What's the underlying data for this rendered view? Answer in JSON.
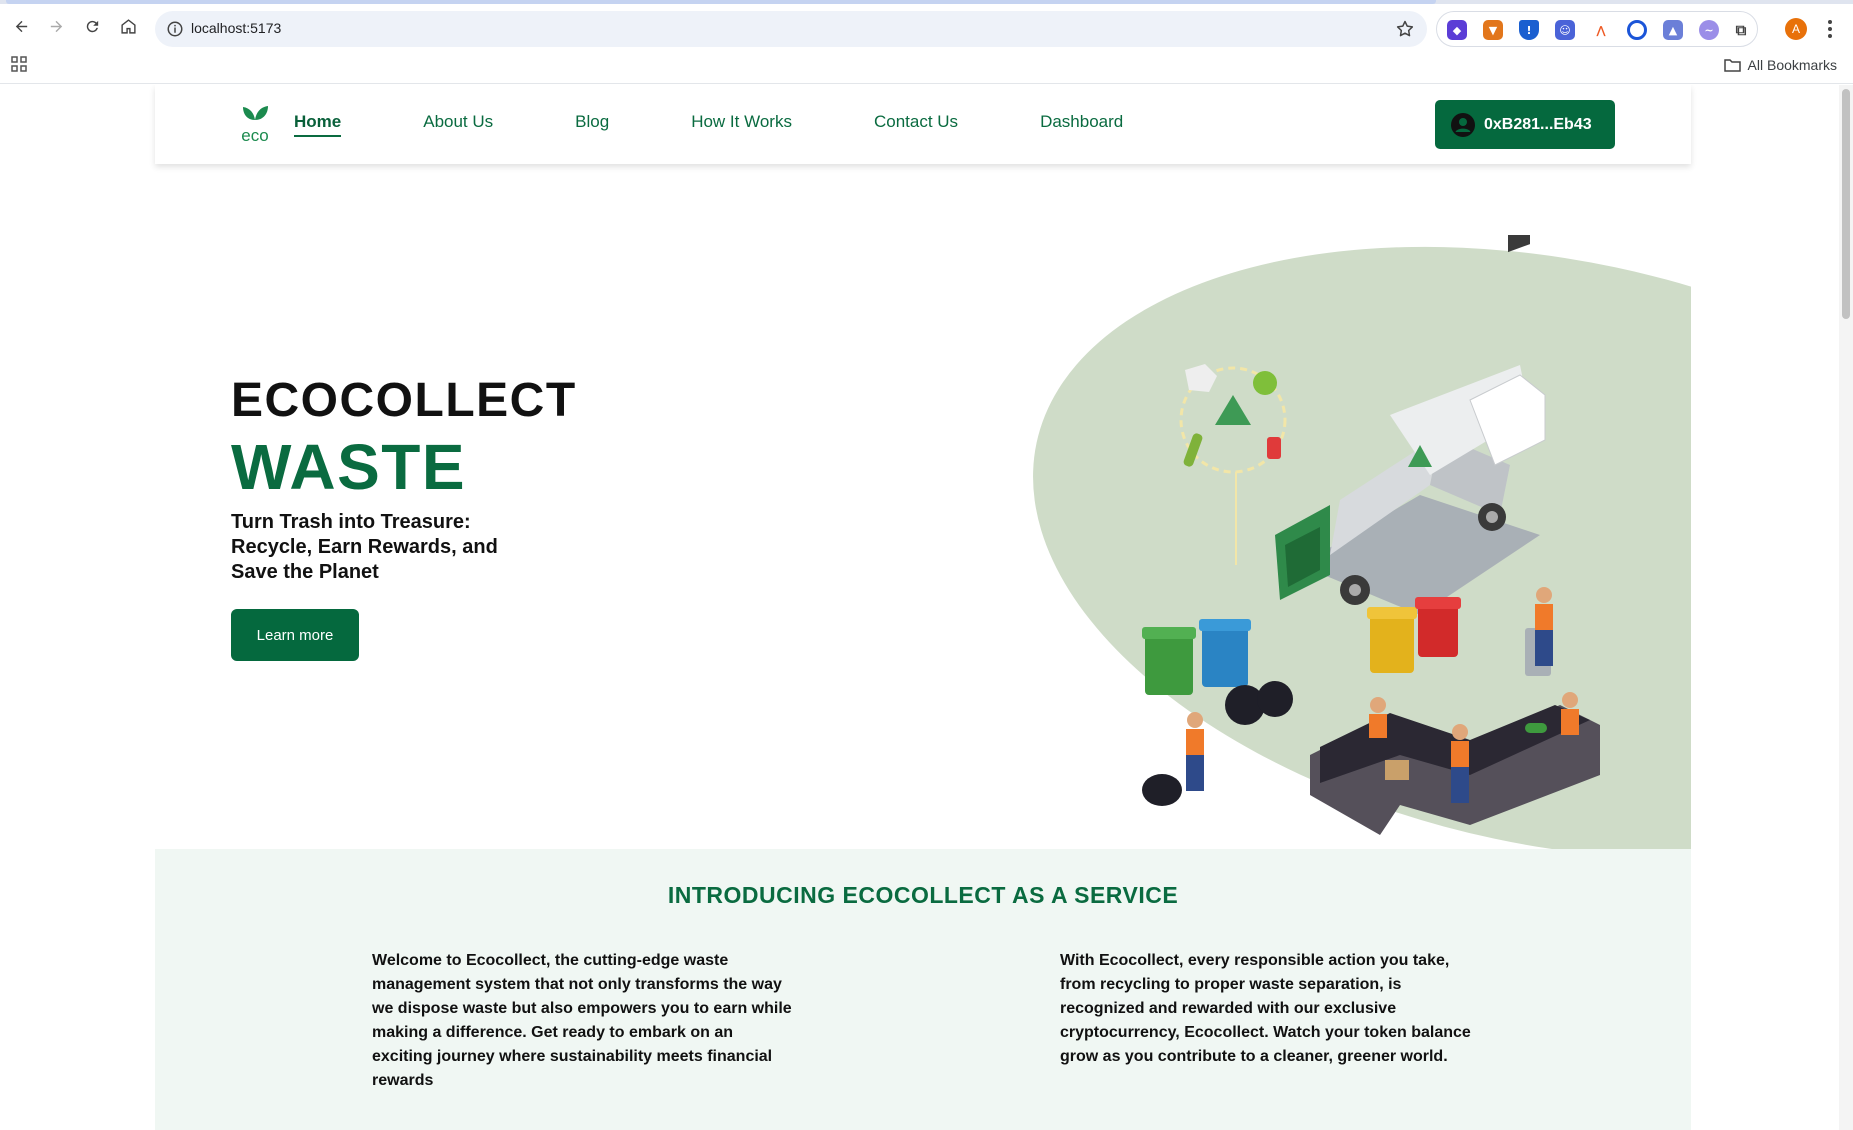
{
  "browser": {
    "url": "localhost:5173",
    "bookmarks_label": "All Bookmarks",
    "avatar_initial": "A",
    "extensions": [
      "multi-wallet-icon",
      "metamask-fox-icon",
      "shield-icon",
      "robot-icon",
      "arweave-icon",
      "circle-ring-icon",
      "hat-icon",
      "puzzle-icon"
    ]
  },
  "header": {
    "nav": [
      {
        "label": "Home",
        "active": true
      },
      {
        "label": "About Us"
      },
      {
        "label": "Blog"
      },
      {
        "label": "How It Works"
      },
      {
        "label": "Contact Us"
      },
      {
        "label": "Dashboard"
      }
    ],
    "wallet_label": "0xB281...Eb43",
    "logo_text": "eco"
  },
  "hero": {
    "title_line1": "ECOCOLLECT",
    "title_line2": "WASTE",
    "subtitle": "Turn Trash into Treasure: Recycle, Earn Rewards, and Save the Planet",
    "cta_label": "Learn more"
  },
  "intro": {
    "title": "INTRODUCING ECOCOLLECT AS A SERVICE",
    "left_text": "Welcome to Ecocollect, the cutting-edge waste management system that not only transforms the way we dispose waste but also empowers you to earn while making a difference. Get ready to embark on an exciting journey where sustainability meets financial rewards",
    "right_text": "With Ecocollect, every responsible action you take, from recycling to proper waste separation, is recognized and rewarded with our exclusive cryptocurrency, Ecocollect. Watch your token balance grow as you contribute to a cleaner, greener world."
  },
  "colors": {
    "brand_green": "#05693e",
    "intro_bg": "#f0f7f3",
    "blob_green": "#cfdcc8"
  }
}
